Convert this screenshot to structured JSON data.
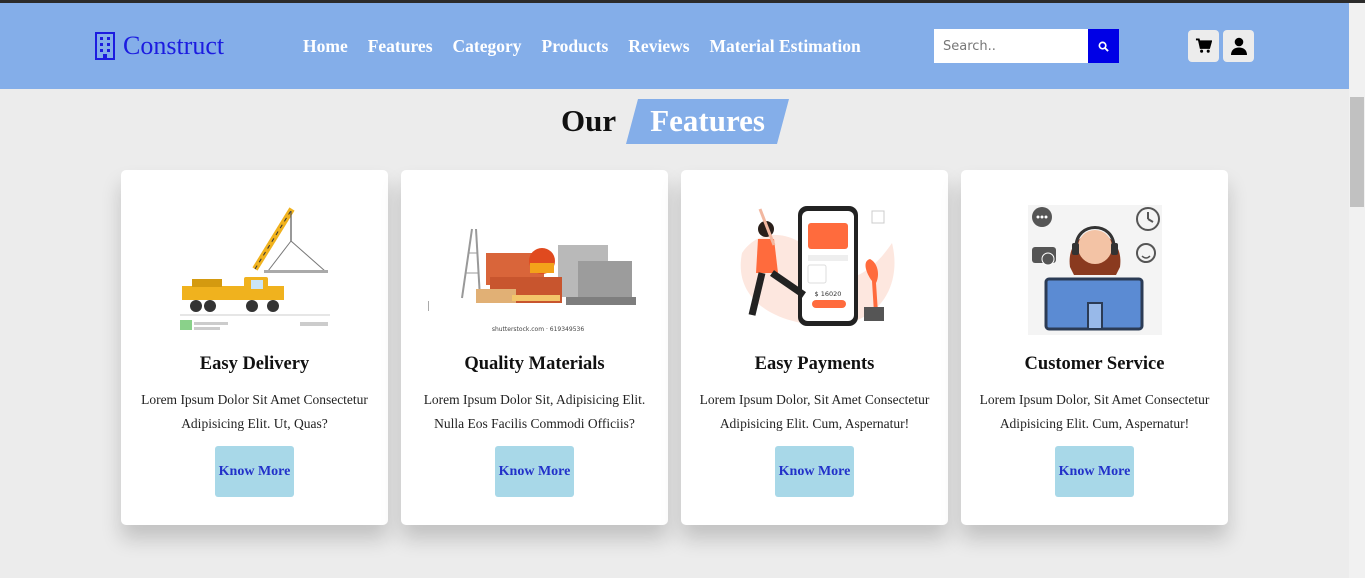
{
  "brand": {
    "name": "Construct",
    "icon": "building-icon",
    "color": "#1c1ce0"
  },
  "nav": {
    "items": [
      {
        "label": "Home"
      },
      {
        "label": "Features"
      },
      {
        "label": "Category"
      },
      {
        "label": "Products"
      },
      {
        "label": "Reviews"
      },
      {
        "label": "Material Estimation"
      }
    ]
  },
  "search": {
    "placeholder": "Search..",
    "value": "",
    "button_icon": "search-icon"
  },
  "header_icons": [
    {
      "icon": "cart-icon"
    },
    {
      "icon": "user-icon"
    }
  ],
  "section": {
    "title_plain": "Our",
    "title_highlight": "Features"
  },
  "cards": [
    {
      "title": "Easy Delivery",
      "text": "Lorem Ipsum Dolor Sit Amet Consectetur Adipisicing Elit. Ut, Quas?",
      "button": "Know More",
      "image": "crane-truck-illustration"
    },
    {
      "title": "Quality Materials",
      "text": "Lorem Ipsum Dolor Sit, Adipisicing Elit. Nulla Eos Facilis Commodi Officiis?",
      "button": "Know More",
      "image": "building-materials-illustration",
      "image_caption": "shutterstock.com · 619349536"
    },
    {
      "title": "Easy Payments",
      "text": "Lorem Ipsum Dolor, Sit Amet Consectetur Adipisicing Elit. Cum, Aspernatur!",
      "button": "Know More",
      "image": "mobile-payment-illustration",
      "image_amount": "$ 16020"
    },
    {
      "title": "Customer Service",
      "text": "Lorem Ipsum Dolor, Sit Amet Consectetur Adipisicing Elit. Cum, Aspernatur!",
      "button": "Know More",
      "image": "customer-service-illustration"
    }
  ],
  "colors": {
    "header": "#84aee9",
    "accent": "#0000e6",
    "button_bg": "#a8d8e8",
    "button_text": "#2231c9",
    "page_bg": "#ececec"
  }
}
